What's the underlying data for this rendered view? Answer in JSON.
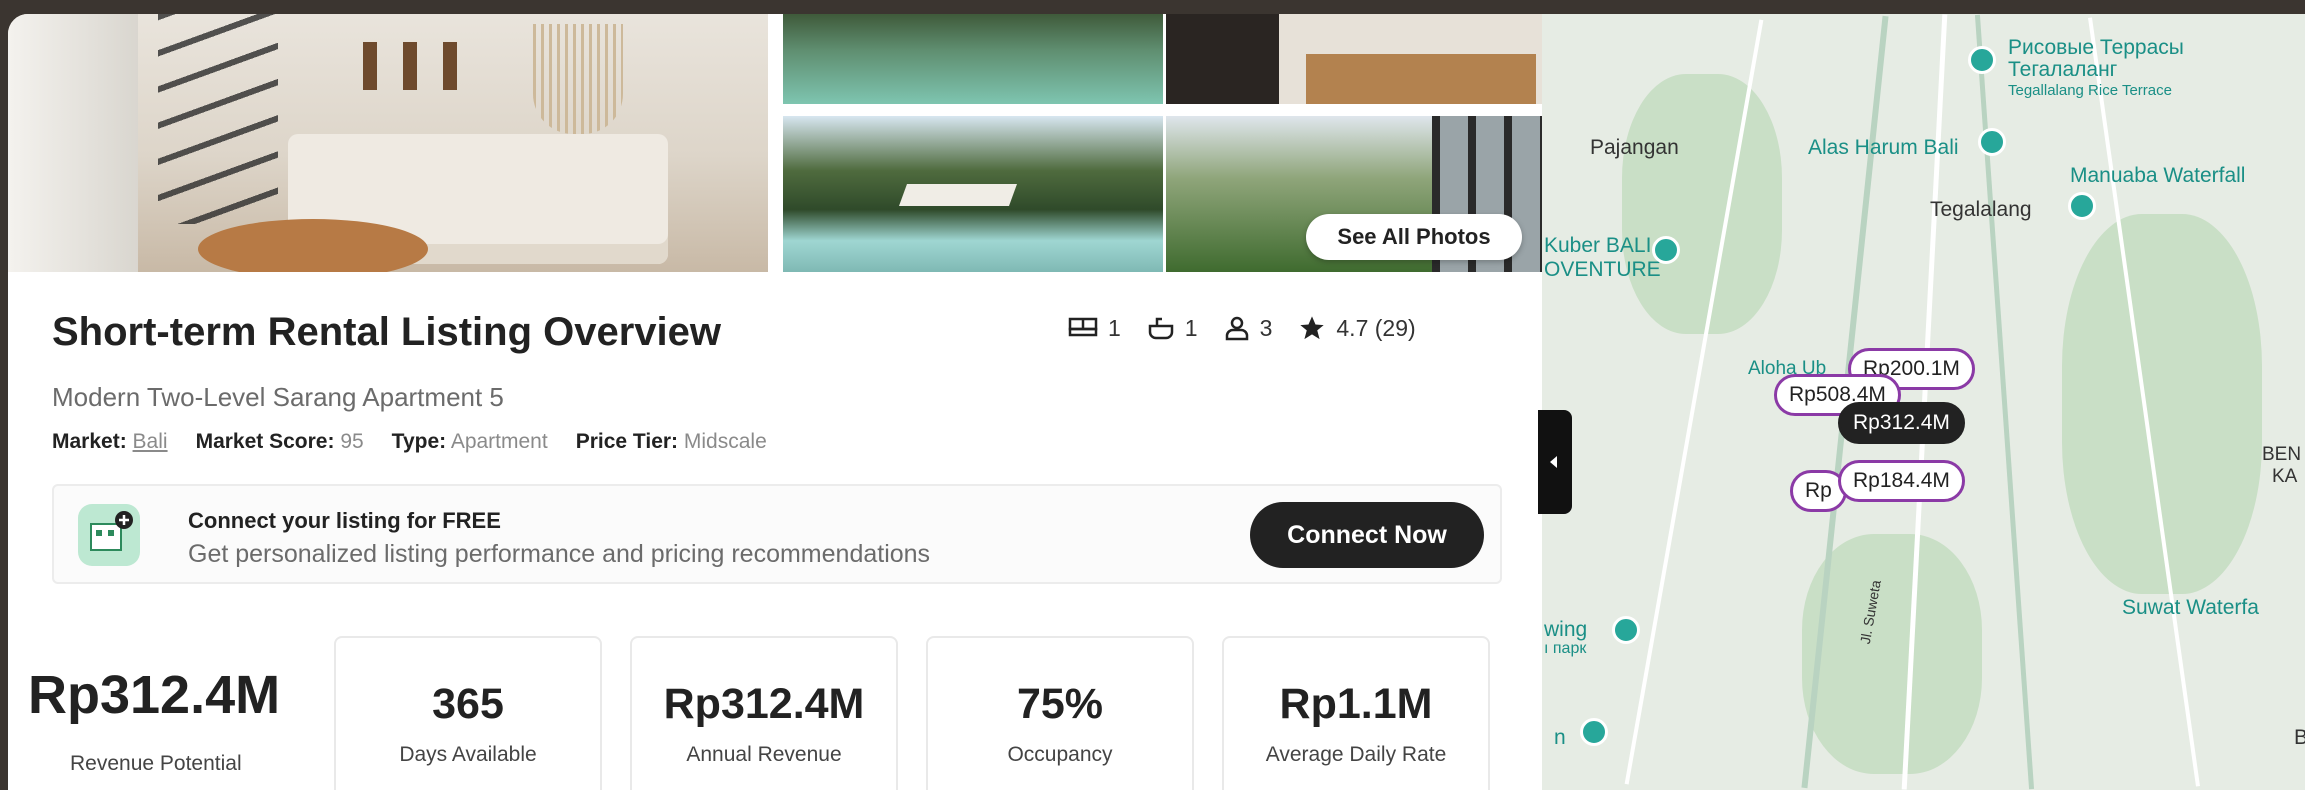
{
  "photos": {
    "see_all_label": "See All Photos"
  },
  "listing": {
    "title": "Short-term Rental Listing Overview",
    "subtitle": "Modern Two-Level Sarang Apartment 5",
    "market_label": "Market:",
    "market_value": "Bali",
    "score_label": "Market Score:",
    "score_value": "95",
    "type_label": "Type:",
    "type_value": "Apartment",
    "tier_label": "Price Tier:",
    "tier_value": "Midscale"
  },
  "stats": {
    "bedrooms": "1",
    "bathrooms": "1",
    "guests": "3",
    "rating": "4.7 (29)",
    "icons": [
      "bed-icon",
      "bath-icon",
      "guests-icon",
      "star-icon"
    ]
  },
  "connect": {
    "title": "Connect your listing for FREE",
    "description": "Get personalized listing performance and pricing recommendations",
    "button_label": "Connect Now"
  },
  "metrics": {
    "revenue_potential_value": "Rp312.4M",
    "revenue_potential_label": "Revenue Potential",
    "cards": [
      {
        "value": "365",
        "label": "Days Available"
      },
      {
        "value": "Rp312.4M",
        "label": "Annual Revenue"
      },
      {
        "value": "75%",
        "label": "Occupancy"
      },
      {
        "value": "Rp1.1M",
        "label": "Average Daily Rate"
      }
    ]
  },
  "map": {
    "pois": {
      "terrace_ru_1": "Рисовые Террасы",
      "terrace_ru_2": "Тегалаланг",
      "terrace_en": "Tegallalang Rice Terrace",
      "pajangan": "Pajangan",
      "alas_harum": "Alas Harum Bali",
      "manuaba": "Manuaba Waterfall",
      "tegalalang": "Tegalalang",
      "kuber_1": "Kuber BALI",
      "kuber_2": "OVENTURE",
      "aloha": "Aloha Ub",
      "benk_1": "BEN",
      "benk_2": "KA",
      "suwat": "Suwat Waterfa",
      "swing_1": "wing",
      "swing_2": "ı парк",
      "n_label": "n",
      "b_label": "B",
      "street": "Jl. Suweta"
    },
    "markers": [
      "Rp200.1M",
      "Rp508.4M",
      "Rp312.4M",
      "Rp",
      "Rp184.4M"
    ],
    "accent_color": "#8b3aa6",
    "poi_color": "#27a79a"
  }
}
